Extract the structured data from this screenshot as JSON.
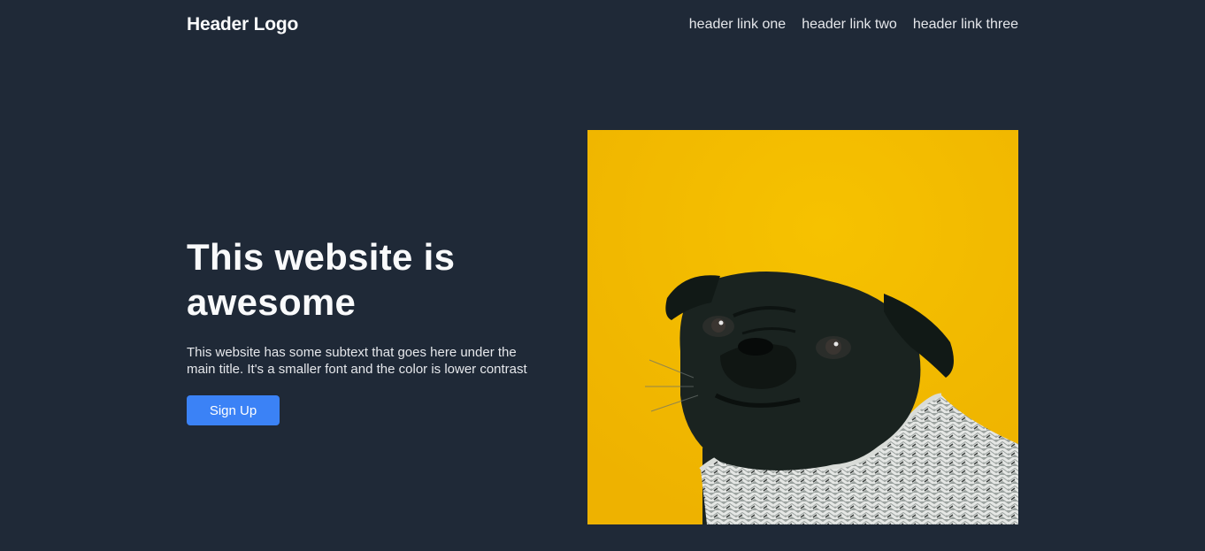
{
  "header": {
    "logo": "Header Logo",
    "links": [
      "header link one",
      "header link two",
      "header link three"
    ]
  },
  "hero": {
    "title_line1": "This website is",
    "title_line2": "awesome",
    "subtext_line1": "This website has some subtext that goes here under the",
    "subtext_line2": "main title. It's a smaller font and the color is lower contrast",
    "button_label": "Sign Up",
    "image_subject": "pug-in-sweater-photo"
  },
  "colors": {
    "background": "#1f2937",
    "image_background": "#f4bb00",
    "button": "#3b82f6",
    "title": "#f9fafb",
    "subtext": "#e5e7eb"
  }
}
